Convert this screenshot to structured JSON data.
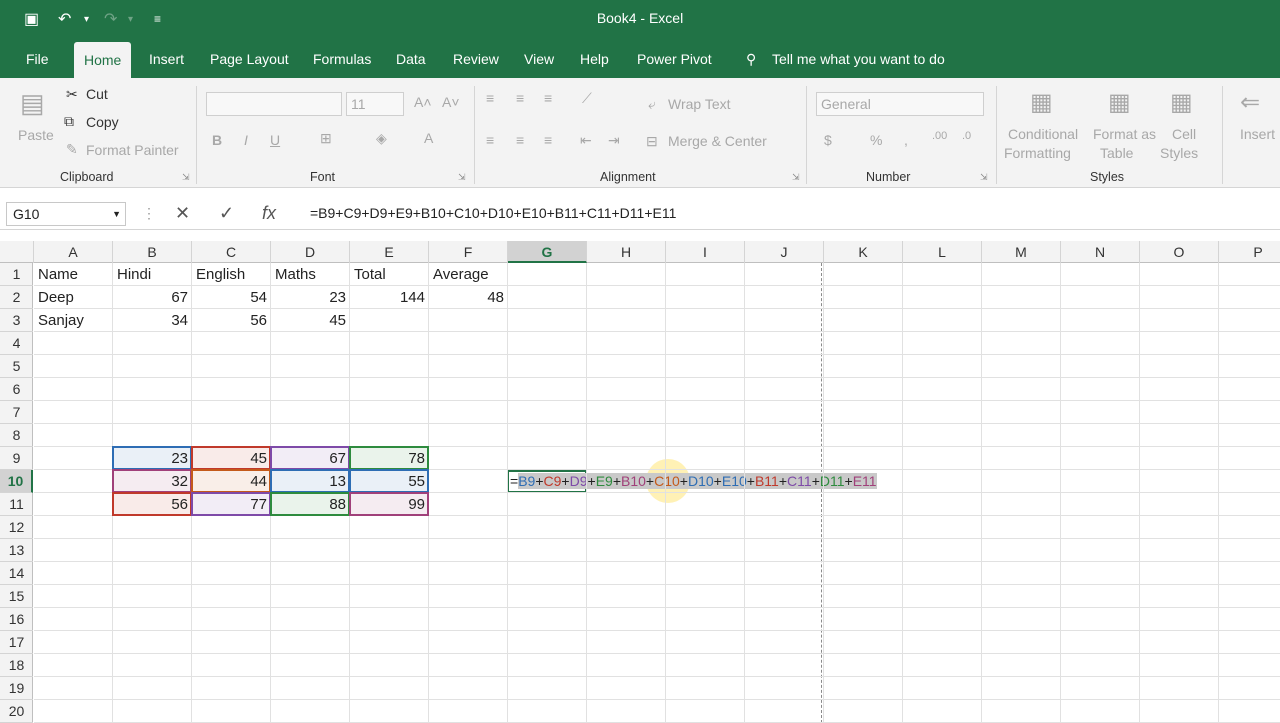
{
  "window": {
    "title": "Book4  -  Excel"
  },
  "tabs": [
    "File",
    "Home",
    "Insert",
    "Page Layout",
    "Formulas",
    "Data",
    "Review",
    "View",
    "Help",
    "Power Pivot"
  ],
  "active_tab": "Home",
  "tell_me": "Tell me what you want to do",
  "ribbon": {
    "clipboard": {
      "paste": "Paste",
      "cut": "Cut",
      "copy": "Copy",
      "format_painter": "Format Painter",
      "group": "Clipboard"
    },
    "font": {
      "size": "11",
      "group": "Font"
    },
    "alignment": {
      "wrap": "Wrap Text",
      "merge": "Merge & Center",
      "group": "Alignment"
    },
    "number": {
      "format": "General",
      "group": "Number"
    },
    "styles": {
      "conditional": "Conditional",
      "formatting": "Formatting",
      "format_as": "Format as",
      "table": "Table",
      "cell": "Cell",
      "cell_styles": "Styles",
      "group": "Styles"
    },
    "cells": {
      "insert": "Insert"
    }
  },
  "name_box": "G10",
  "formula": "=B9+C9+D9+E9+B10+C10+D10+E10+B11+C11+D11+E11",
  "columns": [
    "A",
    "B",
    "C",
    "D",
    "E",
    "F",
    "G",
    "H",
    "I",
    "J",
    "K",
    "L",
    "M",
    "N",
    "O",
    "P"
  ],
  "rows": [
    "1",
    "2",
    "3",
    "4",
    "5",
    "6",
    "7",
    "8",
    "9",
    "10",
    "11",
    "12",
    "13",
    "14",
    "15",
    "16",
    "17",
    "18",
    "19",
    "20"
  ],
  "cells": {
    "A1": "Name",
    "B1": "Hindi",
    "C1": "English",
    "D1": "Maths",
    "E1": "Total",
    "F1": "Average",
    "A2": "Deep",
    "B2": "67",
    "C2": "54",
    "D2": "23",
    "E2": "144",
    "F2": "48",
    "A3": "Sanjay",
    "B3": "34",
    "C3": "56",
    "D3": "45",
    "B9": "23",
    "C9": "45",
    "D9": "67",
    "E9": "78",
    "B10": "32",
    "C10": "44",
    "D10": "13",
    "E10": "55",
    "B11": "56",
    "C11": "77",
    "D11": "88",
    "E11": "99"
  },
  "edit_tokens": [
    "=",
    "B9",
    "+",
    "C9",
    "+",
    "D9",
    "+",
    "E9",
    "+",
    "B10",
    "+",
    "C10",
    "+",
    "D10",
    "+",
    "E10",
    "+",
    "B11",
    "+",
    "C11",
    "+",
    "D11",
    "+",
    "E11"
  ],
  "ref_colors": [
    "#2e6db4",
    "#c0392b",
    "#7e4aa8",
    "#2e8b3e",
    "#a0407a",
    "#c45a1a",
    "#2e6db4",
    "#2e6db4",
    "#c0392b",
    "#7e4aa8",
    "#2e8b3e",
    "#a0407a"
  ]
}
